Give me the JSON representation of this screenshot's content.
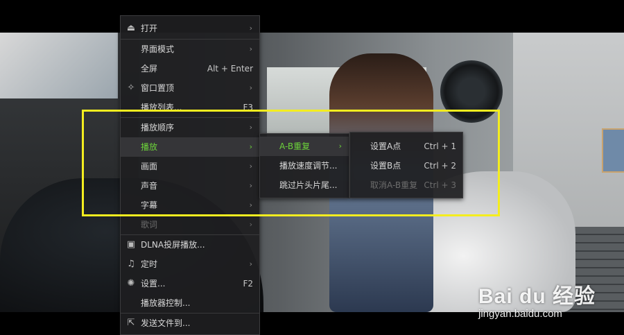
{
  "main_menu": {
    "items": [
      {
        "label": "打开",
        "icon": "eject-icon",
        "shortcut": "",
        "submenu": true
      },
      {
        "label": "界面模式",
        "icon": "",
        "shortcut": "",
        "submenu": true
      },
      {
        "label": "全屏",
        "icon": "",
        "shortcut": "Alt + Enter",
        "submenu": false
      },
      {
        "label": "窗口置顶",
        "icon": "pin-icon",
        "shortcut": "",
        "submenu": true
      },
      {
        "label": "播放列表...",
        "icon": "",
        "shortcut": "F3",
        "submenu": false
      },
      {
        "label": "播放顺序",
        "icon": "",
        "shortcut": "",
        "submenu": true
      },
      {
        "label": "播放",
        "icon": "",
        "shortcut": "",
        "submenu": true,
        "active": true
      },
      {
        "label": "画面",
        "icon": "",
        "shortcut": "",
        "submenu": true
      },
      {
        "label": "声音",
        "icon": "",
        "shortcut": "",
        "submenu": true
      },
      {
        "label": "字幕",
        "icon": "",
        "shortcut": "",
        "submenu": true
      },
      {
        "label": "歌词",
        "icon": "",
        "shortcut": "",
        "submenu": true,
        "disabled": true
      },
      {
        "label": "DLNA投屏播放...",
        "icon": "tv-icon",
        "shortcut": "",
        "submenu": false
      },
      {
        "label": "定时",
        "icon": "bell-icon",
        "shortcut": "",
        "submenu": true
      },
      {
        "label": "设置...",
        "icon": "gear-icon",
        "shortcut": "F2",
        "submenu": false
      },
      {
        "label": "播放器控制...",
        "icon": "",
        "shortcut": "",
        "submenu": false
      },
      {
        "label": "发送文件到...",
        "icon": "send-icon",
        "shortcut": "",
        "submenu": false
      }
    ]
  },
  "play_submenu": {
    "items": [
      {
        "label": "A-B重复",
        "submenu": true,
        "active": true
      },
      {
        "label": "播放速度调节...",
        "submenu": false
      },
      {
        "label": "跳过片头片尾...",
        "submenu": false
      }
    ]
  },
  "ab_submenu": {
    "items": [
      {
        "label": "设置A点",
        "shortcut": "Ctrl + 1"
      },
      {
        "label": "设置B点",
        "shortcut": "Ctrl + 2"
      },
      {
        "label": "取消A-B重复",
        "shortcut": "Ctrl + 3",
        "disabled": true
      }
    ]
  },
  "watermark": {
    "logo": "Bai du 经验",
    "url": "jingyan.baidu.com"
  },
  "colors": {
    "active_text": "#6cd23a",
    "highlight_border": "#f4ed1f",
    "menu_bg": "#1e1e20"
  }
}
